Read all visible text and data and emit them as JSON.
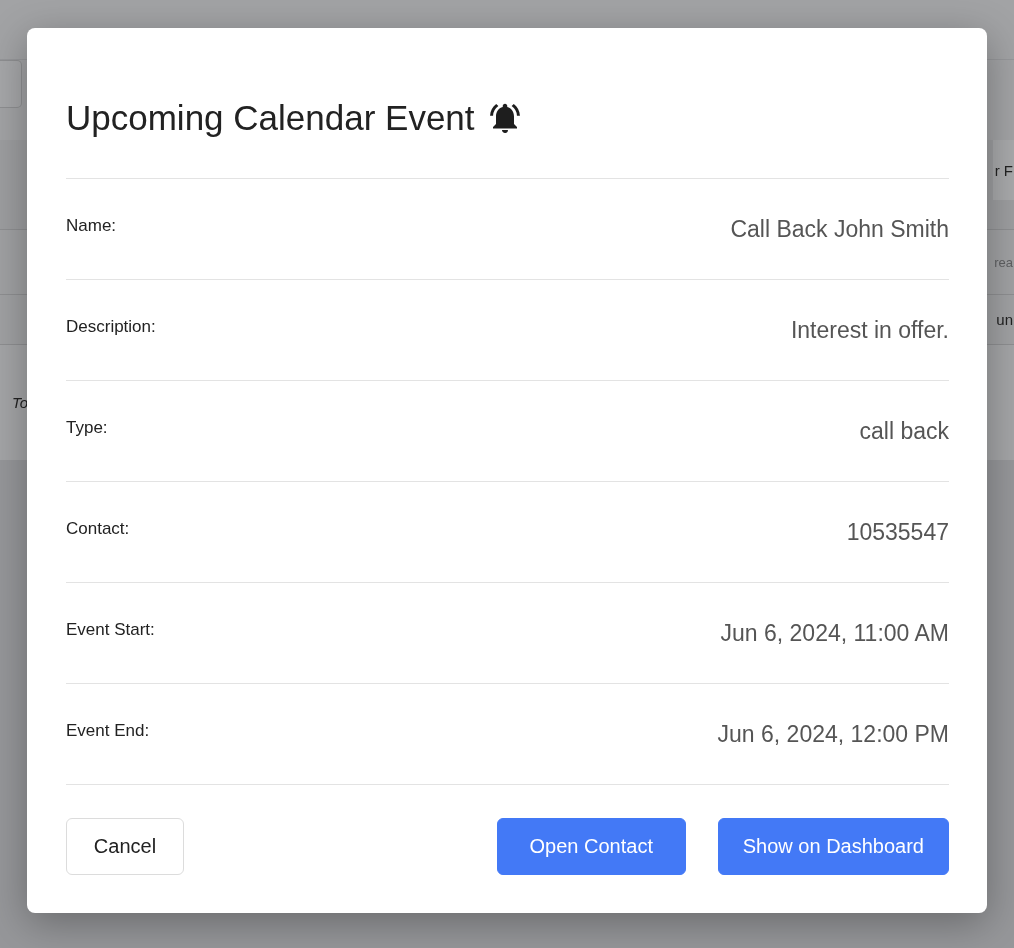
{
  "background": {
    "right_fragments": [
      {
        "text": "r F",
        "kind": "button"
      },
      {
        "text": "rea",
        "kind": "muted"
      },
      {
        "text": "un",
        "kind": "plain"
      }
    ],
    "left_fragments": [
      {
        "text": "To",
        "kind": "italic"
      }
    ]
  },
  "dialog": {
    "title": "Upcoming Calendar Event",
    "fields": [
      {
        "label": "Name:",
        "value": "Call Back John Smith"
      },
      {
        "label": "Description:",
        "value": "Interest in offer."
      },
      {
        "label": "Type:",
        "value": "call back"
      },
      {
        "label": "Contact:",
        "value": "10535547"
      },
      {
        "label": "Event Start:",
        "value": "Jun 6, 2024, 11:00 AM"
      },
      {
        "label": "Event End:",
        "value": "Jun 6, 2024, 12:00 PM"
      }
    ],
    "buttons": [
      {
        "label": "Cancel",
        "kind": "secondary"
      },
      {
        "label": "Open Contact",
        "kind": "primary"
      },
      {
        "label": "Show on Dashboard",
        "kind": "primary"
      }
    ]
  }
}
